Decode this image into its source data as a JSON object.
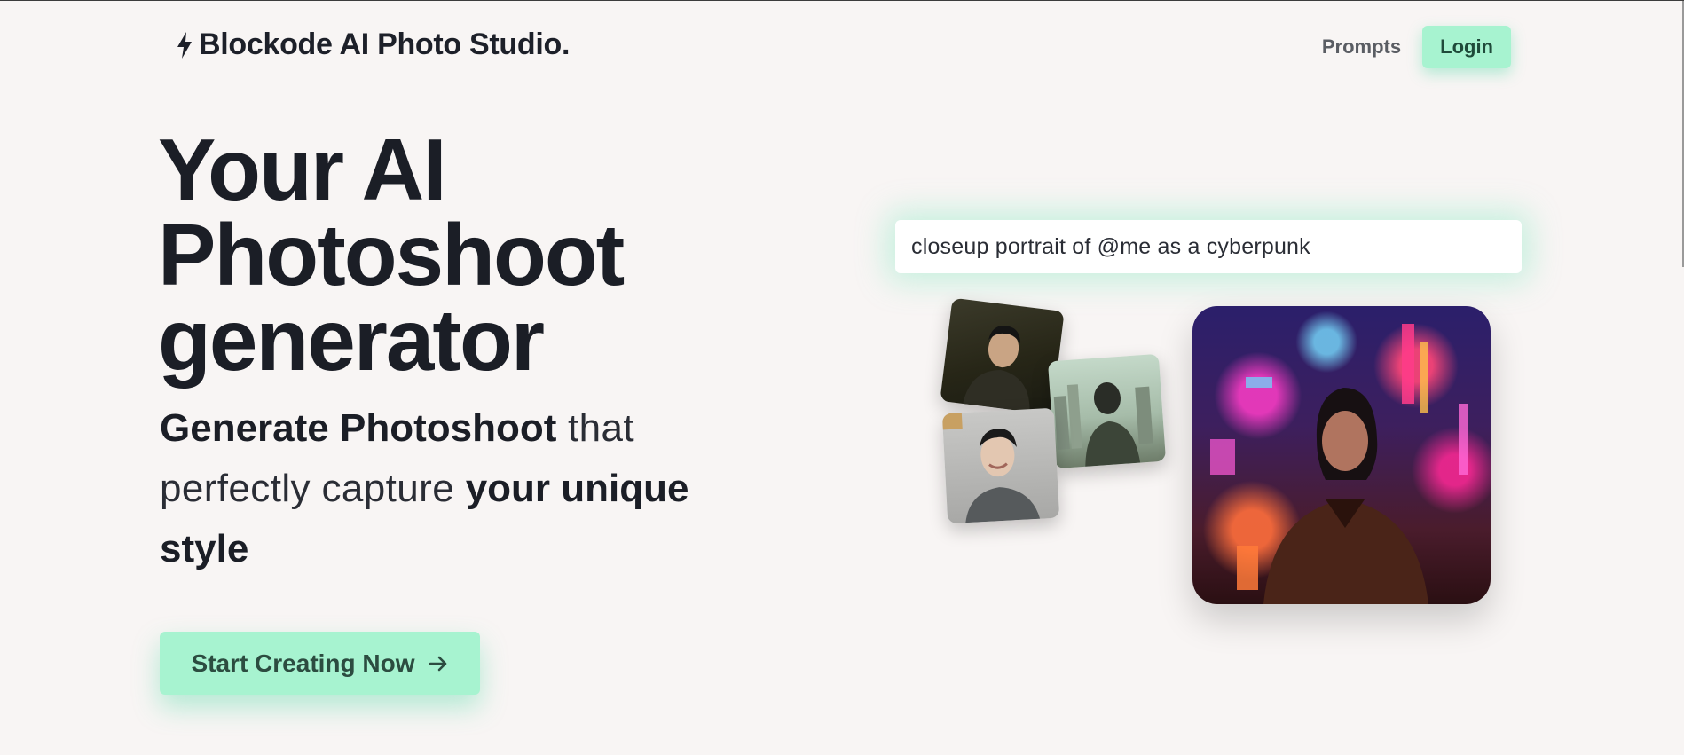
{
  "header": {
    "brand": "Blockode AI Photo Studio.",
    "brand_icon": "lightning-bolt-icon",
    "nav": {
      "prompts_label": "Prompts",
      "login_label": "Login"
    }
  },
  "hero": {
    "title": "Your AI Photoshoot generator",
    "subtitle": {
      "part1_bold": "Generate Photoshoot",
      "part2": " that perfectly capture ",
      "part3_bold": "your unique style"
    },
    "cta_label": "Start Creating Now",
    "cta_icon": "arrow-right-icon"
  },
  "showcase": {
    "prompt_text": "closeup portrait of @me as a cyberpunk",
    "images": [
      {
        "name": "portrait-dark-suit"
      },
      {
        "name": "portrait-city-back"
      },
      {
        "name": "portrait-smiling"
      }
    ],
    "main_image": {
      "name": "cyberpunk-portrait-result"
    }
  },
  "colors": {
    "accent": "#a7f3d0",
    "accent_text": "#1f4a3a",
    "background": "#f8f5f4",
    "heading": "#1b1e26"
  }
}
